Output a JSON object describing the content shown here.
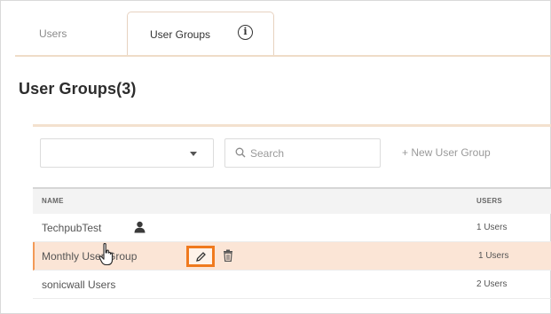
{
  "tabs": [
    {
      "label": "Users",
      "active": false
    },
    {
      "label": "User Groups",
      "active": true
    }
  ],
  "info_icon_glyph": "i",
  "page_title": "User Groups(3)",
  "toolbar": {
    "dropdown_value": "",
    "search_placeholder": "Search",
    "new_group_label": "+ New User Group"
  },
  "table": {
    "columns": [
      "NAME",
      "USERS"
    ],
    "rows": [
      {
        "name": "TechpubTest",
        "users": "1 Users",
        "icon": "user-icon"
      },
      {
        "name": "Monthly User Group",
        "users": "1 Users",
        "actions": [
          "edit-icon",
          "delete-icon"
        ],
        "selected": true
      },
      {
        "name": "sonicwall Users",
        "users": "2 Users"
      }
    ]
  },
  "colors": {
    "accent": "#f07a1e",
    "selected_row": "#fbe5d6",
    "tab_border": "#e7d2c0",
    "header_bg": "#f3f3f3"
  }
}
